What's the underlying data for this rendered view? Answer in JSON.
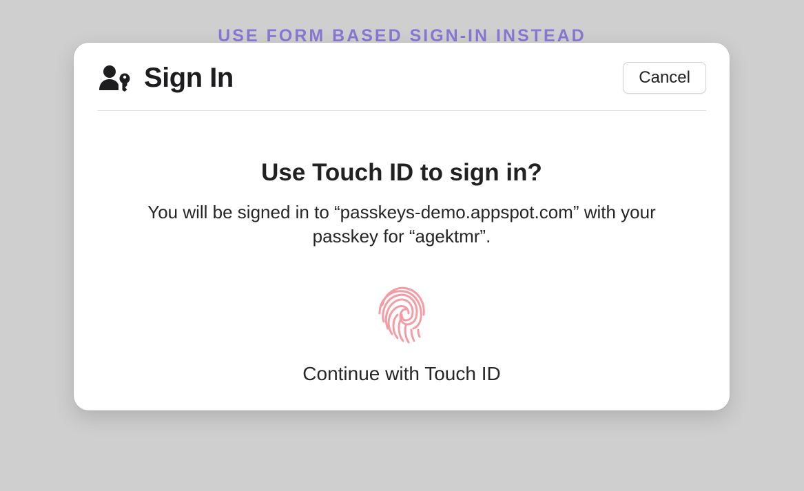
{
  "background": {
    "link_text": "USE FORM BASED SIGN-IN INSTEAD"
  },
  "dialog": {
    "title": "Sign In",
    "cancel_label": "Cancel",
    "prompt_title": "Use Touch ID to sign in?",
    "prompt_description": "You will be signed in to “passkeys-demo.appspot.com” with your passkey for “agektmr”.",
    "continue_label": "Continue with Touch ID"
  },
  "colors": {
    "link": "#8977d3",
    "fingerprint": "#f59ba3",
    "text": "#1d1d1f"
  }
}
